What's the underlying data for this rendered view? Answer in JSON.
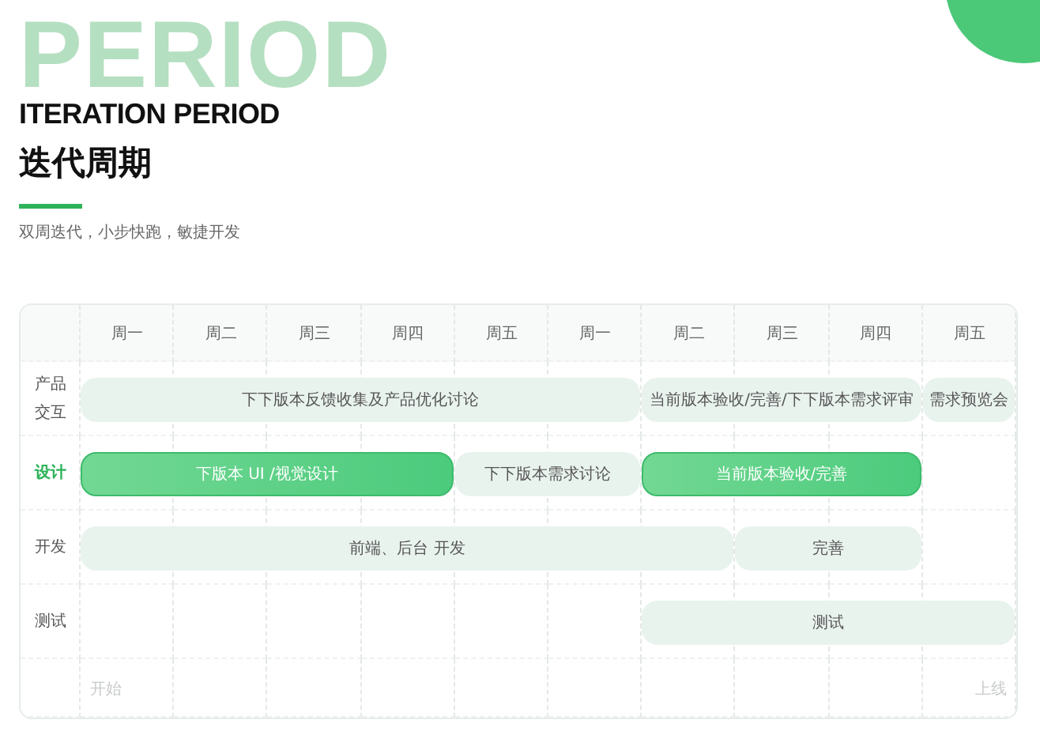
{
  "background_word": "PERIOD",
  "title_en": "ITERATION PERIOD",
  "title_cn": "迭代周期",
  "subtitle": "双周迭代，小步快跑，敏捷开发",
  "days": [
    "周一",
    "周二",
    "周三",
    "周四",
    "周五",
    "周一",
    "周二",
    "周三",
    "周四",
    "周五"
  ],
  "rows": [
    {
      "label": "产品交互",
      "selected": false,
      "bars": [
        {
          "text": "下下版本反馈收集及产品优化讨论",
          "kind": "soft"
        },
        {
          "text": "当前版本验收/完善/下下版本需求评审",
          "kind": "soft"
        },
        {
          "text": "需求预览会",
          "kind": "soft"
        }
      ]
    },
    {
      "label": "设计",
      "selected": true,
      "bars": [
        {
          "text": "下版本 UI /视觉设计",
          "kind": "primary"
        },
        {
          "text": "下下版本需求讨论",
          "kind": "soft"
        },
        {
          "text": "当前版本验收/完善",
          "kind": "primary"
        }
      ]
    },
    {
      "label": "开发",
      "selected": false,
      "bars": [
        {
          "text": "前端、后台 开发",
          "kind": "soft"
        },
        {
          "text": "完善",
          "kind": "soft"
        }
      ]
    },
    {
      "label": "测试",
      "selected": false,
      "bars": [
        {
          "text": "测试",
          "kind": "soft"
        }
      ]
    }
  ],
  "footer": {
    "start": "开始",
    "end": "上线"
  }
}
